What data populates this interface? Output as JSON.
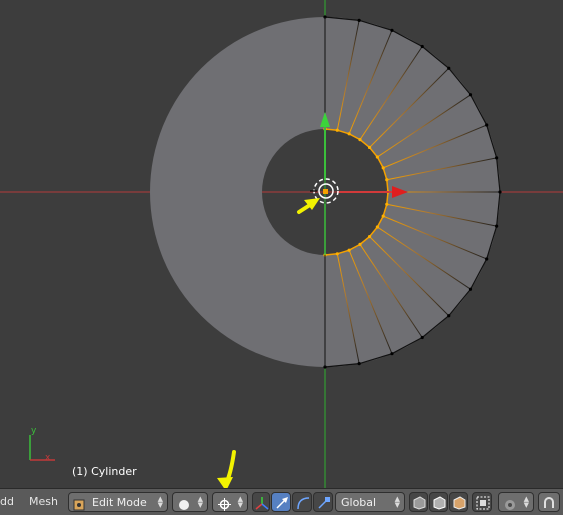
{
  "viewport": {
    "object_label": "(1) Cylinder",
    "axis_x_label": "x",
    "axis_y_label": "y",
    "colors": {
      "background": "#3d3d3d",
      "mesh_face": "#6f6f73",
      "selected_edge": "#f5a100",
      "x_axis": "#c23a3a",
      "y_axis": "#3bbf3b",
      "annotation_arrow": "#f2f200"
    }
  },
  "header": {
    "menu_partial": "dd",
    "menu_mesh": "Mesh",
    "mode": "Edit Mode",
    "orientation": "Global",
    "icons": [
      "mode-icon",
      "viewport-shading-icon",
      "pivot-point-icon",
      "manipulator-axes-icon",
      "translate-icon",
      "rotate-icon",
      "scale-icon",
      "vertex-select-icon",
      "edge-select-icon",
      "face-select-icon",
      "limit-selection-icon",
      "proportional-edit-icon",
      "snap-icon"
    ]
  }
}
